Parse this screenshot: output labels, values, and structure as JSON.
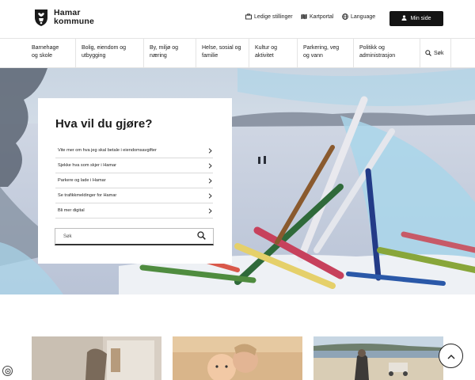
{
  "brand": {
    "name_line1": "Hamar",
    "name_line2": "kommune"
  },
  "utility": {
    "jobs": "Ledige stillinger",
    "map": "Kartportal",
    "language": "Language"
  },
  "account": {
    "label": "Min side"
  },
  "nav": {
    "items": [
      {
        "line1": "Barnehage",
        "line2": "og skole"
      },
      {
        "line1": "Bolig, eiendom og",
        "line2": "utbygging"
      },
      {
        "line1": "By, miljø og",
        "line2": "næring"
      },
      {
        "line1": "Helse, sosial og",
        "line2": "familie"
      },
      {
        "line1": "Kultur og",
        "line2": "aktivitet"
      },
      {
        "line1": "Parkering, veg",
        "line2": "og vann"
      },
      {
        "line1": "Politikk og",
        "line2": "administrasjon"
      }
    ],
    "search": "Søk"
  },
  "hero": {
    "title": "Hva vil du gjøre?",
    "links": [
      "Vite mer om hva jeg skal betale i eiendomsavgifter",
      "Sjekke hva som skjer i Hamar",
      "Parkere og lade i Hamar",
      "Se trafikkmeldinger for Hamar",
      "Bli mer digital"
    ],
    "search_placeholder": "Søk"
  },
  "colors": {
    "accent": "#141414",
    "hero_blue": "#a9d6ea"
  },
  "icons": {
    "logo": "coat-of-arms-icon",
    "jobs": "briefcase-icon",
    "map": "map-icon",
    "language": "globe-icon",
    "account": "user-icon",
    "search": "search-icon",
    "link": "chevron-right-icon",
    "scroll": "chevron-up-icon"
  }
}
